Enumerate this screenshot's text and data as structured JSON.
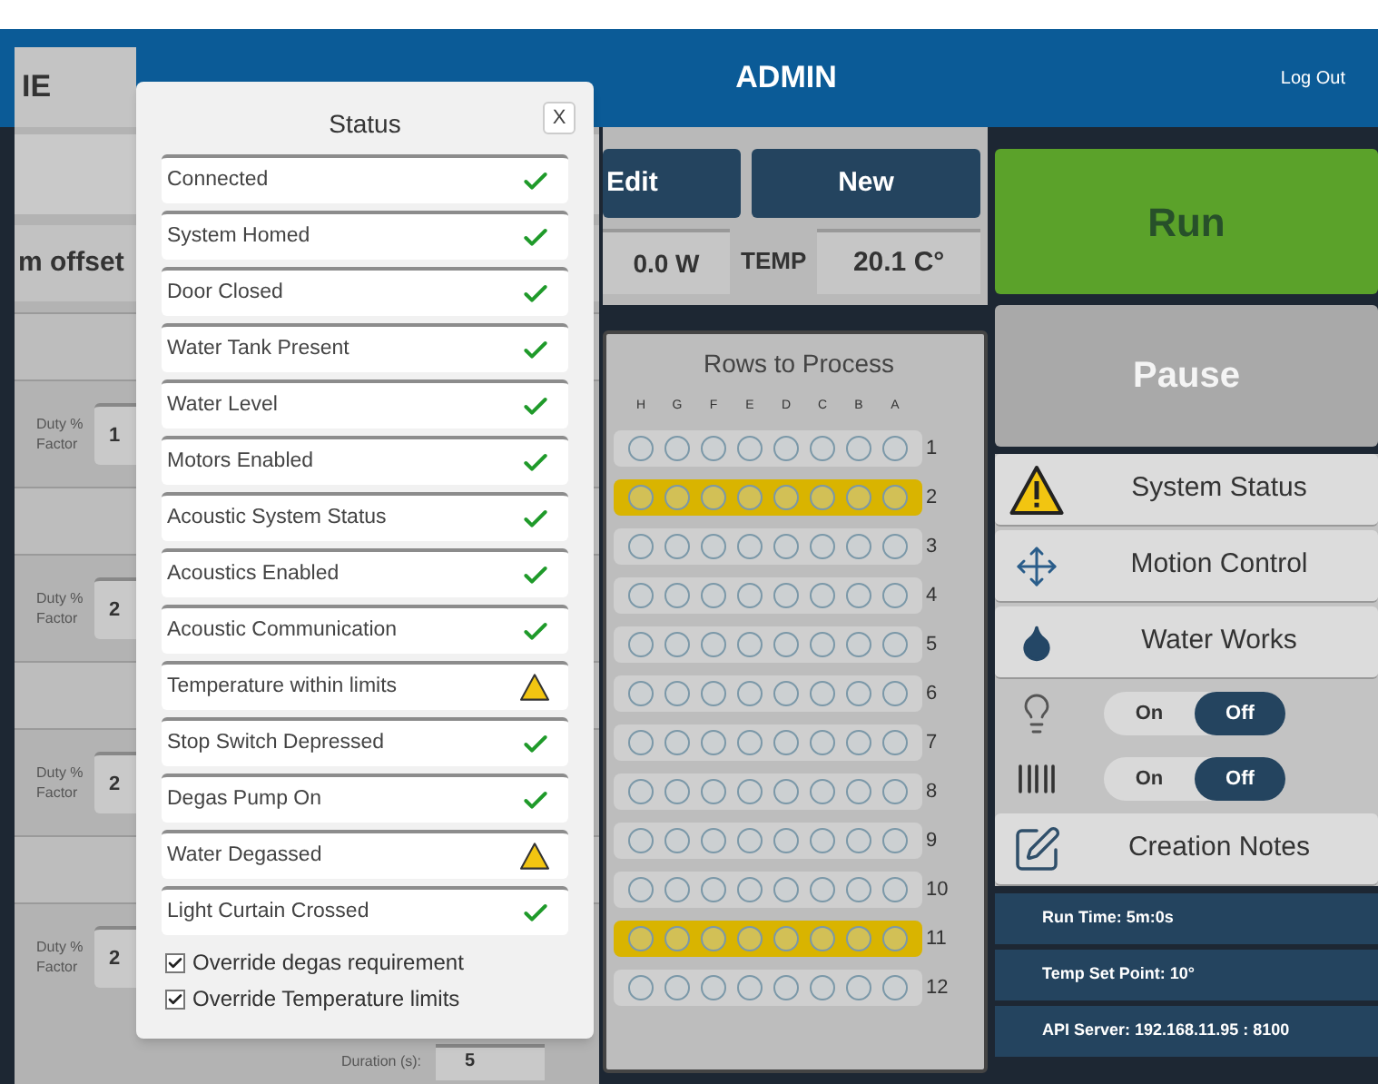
{
  "header": {
    "tabs": [
      {
        "label": "IE",
        "selected": true
      },
      {
        "label": "ADMIN",
        "selected": false
      }
    ],
    "logout": "Log Out"
  },
  "left_panel": {
    "offset_label": "m offset",
    "duty_rows": [
      {
        "label": "Duty % Factor",
        "value": "1"
      },
      {
        "label": "Duty % Factor",
        "value": "2"
      },
      {
        "label": "Duty % Factor",
        "value": "2"
      },
      {
        "label": "Duty % Factor",
        "value": "2"
      }
    ],
    "duration": {
      "label": "Duration (s):",
      "value": "5"
    }
  },
  "recipe": {
    "buttons": [
      "Edit",
      "New"
    ],
    "power": "0.0 W",
    "temp_label": "TEMP",
    "temp": "20.1 C°"
  },
  "rows_panel": {
    "title": "Rows to Process",
    "columns": [
      "H",
      "G",
      "F",
      "E",
      "D",
      "C",
      "B",
      "A"
    ],
    "rows": [
      {
        "label": "1",
        "selected": false
      },
      {
        "label": "2",
        "selected": true
      },
      {
        "label": "3",
        "selected": false
      },
      {
        "label": "4",
        "selected": false
      },
      {
        "label": "5",
        "selected": false
      },
      {
        "label": "6",
        "selected": false
      },
      {
        "label": "7",
        "selected": false
      },
      {
        "label": "8",
        "selected": false
      },
      {
        "label": "9",
        "selected": false
      },
      {
        "label": "10",
        "selected": false
      },
      {
        "label": "11",
        "selected": true
      },
      {
        "label": "12",
        "selected": false
      }
    ]
  },
  "controls": {
    "run": "Run",
    "pause": {
      "label": "Pause",
      "disabled": true
    },
    "tools": [
      {
        "kind": "button",
        "label": "System Status"
      },
      {
        "kind": "button",
        "label": "Motion Control"
      },
      {
        "kind": "button",
        "label": "Water Works"
      },
      {
        "kind": "toggle",
        "on_label": "On",
        "off_label": "Off",
        "on": false
      },
      {
        "kind": "toggle",
        "on_label": "On",
        "off_label": "Off",
        "on": false
      },
      {
        "kind": "button",
        "label": "Creation Notes"
      }
    ],
    "info": [
      "Run Time: 5m:0s",
      "Temp Set Point: 10°",
      "API Server: 192.168.11.95 : 8100"
    ]
  },
  "status_dialog": {
    "title": "Status",
    "close": "X",
    "items": [
      {
        "label": "Connected",
        "ok": true
      },
      {
        "label": "System Homed",
        "ok": true
      },
      {
        "label": "Door Closed",
        "ok": true
      },
      {
        "label": "Water Tank Present",
        "ok": true
      },
      {
        "label": "Water Level",
        "ok": true
      },
      {
        "label": "Motors Enabled",
        "ok": true
      },
      {
        "label": "Acoustic System Status",
        "ok": true
      },
      {
        "label": "Acoustics Enabled",
        "ok": true
      },
      {
        "label": "Acoustic Communication",
        "ok": true
      },
      {
        "label": "Temperature within limits",
        "ok": false
      },
      {
        "label": "Stop Switch Depressed",
        "ok": true
      },
      {
        "label": "Degas Pump On",
        "ok": true
      },
      {
        "label": "Water Degassed",
        "ok": false
      },
      {
        "label": "Light Curtain Crossed",
        "ok": true
      }
    ],
    "overrides": [
      {
        "label": "Override degas requirement",
        "checked": true
      },
      {
        "label": "Override Temperature limits",
        "checked": true
      }
    ]
  }
}
